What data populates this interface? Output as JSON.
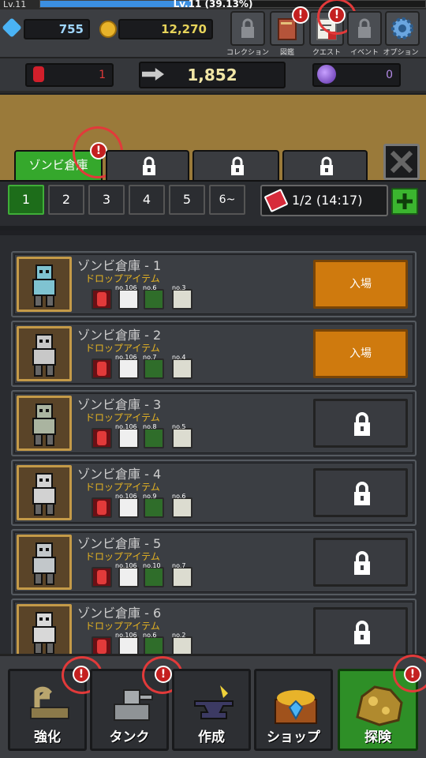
{
  "player": {
    "level_left": "Lv.11",
    "level_center": "Lv.11 (39.13%)",
    "xp_fraction": 0.3913
  },
  "resources": {
    "gems": "755",
    "gold": "12,270"
  },
  "top_buttons": [
    {
      "label": "コレクション",
      "icon": "lock-icon",
      "alert": false
    },
    {
      "label": "図鑑",
      "icon": "book-icon",
      "alert": true
    },
    {
      "label": "クエスト",
      "icon": "quest-scroll-icon",
      "alert": true
    },
    {
      "label": "イベント",
      "icon": "lock-icon",
      "alert": false
    },
    {
      "label": "オプション",
      "icon": "gear-icon",
      "alert": false
    }
  ],
  "currencies": {
    "red": "1",
    "main": "1,852",
    "purple": "0"
  },
  "tabs": [
    {
      "label": "ゾンビ倉庫",
      "active": true
    },
    {
      "label": "",
      "locked": true
    },
    {
      "label": "",
      "locked": true
    },
    {
      "label": "",
      "locked": true
    }
  ],
  "pages": [
    "1",
    "2",
    "3",
    "4",
    "5",
    "6~"
  ],
  "ticket": {
    "text": "1/2 (14:17)"
  },
  "rows": [
    {
      "title": "ゾンビ倉庫 - 1",
      "subtitle": "ドロップアイテム",
      "items": [
        "",
        "no.106",
        "no.6",
        "no.3"
      ],
      "action": "入場",
      "locked": false
    },
    {
      "title": "ゾンビ倉庫 - 2",
      "subtitle": "ドロップアイテム",
      "items": [
        "",
        "no.106",
        "no.7",
        "no.4"
      ],
      "action": "入場",
      "locked": false
    },
    {
      "title": "ゾンビ倉庫 - 3",
      "subtitle": "ドロップアイテム",
      "items": [
        "",
        "no.106",
        "no.8",
        "no.5"
      ],
      "action": "",
      "locked": true
    },
    {
      "title": "ゾンビ倉庫 - 4",
      "subtitle": "ドロップアイテム",
      "items": [
        "",
        "no.106",
        "no.9",
        "no.6"
      ],
      "action": "",
      "locked": true
    },
    {
      "title": "ゾンビ倉庫 - 5",
      "subtitle": "ドロップアイテム",
      "items": [
        "",
        "no.106",
        "no.10",
        "no.7"
      ],
      "action": "",
      "locked": true
    },
    {
      "title": "ゾンビ倉庫 - 6",
      "subtitle": "ドロップアイテム",
      "items": [
        "",
        "no.106",
        "no.6",
        "no.2"
      ],
      "action": "",
      "locked": true
    }
  ],
  "nav": [
    {
      "label": "強化",
      "alert": true,
      "active": false
    },
    {
      "label": "タンク",
      "alert": true,
      "active": false
    },
    {
      "label": "作成",
      "alert": false,
      "active": false
    },
    {
      "label": "ショップ",
      "alert": false,
      "active": false
    },
    {
      "label": "探険",
      "alert": true,
      "active": true
    }
  ],
  "alert_glyph": "!",
  "colors": {
    "accent_green": "#35a82c",
    "enter_orange": "#cf7a0e",
    "alert_red": "#c42020",
    "gold_text": "#e6b422"
  }
}
